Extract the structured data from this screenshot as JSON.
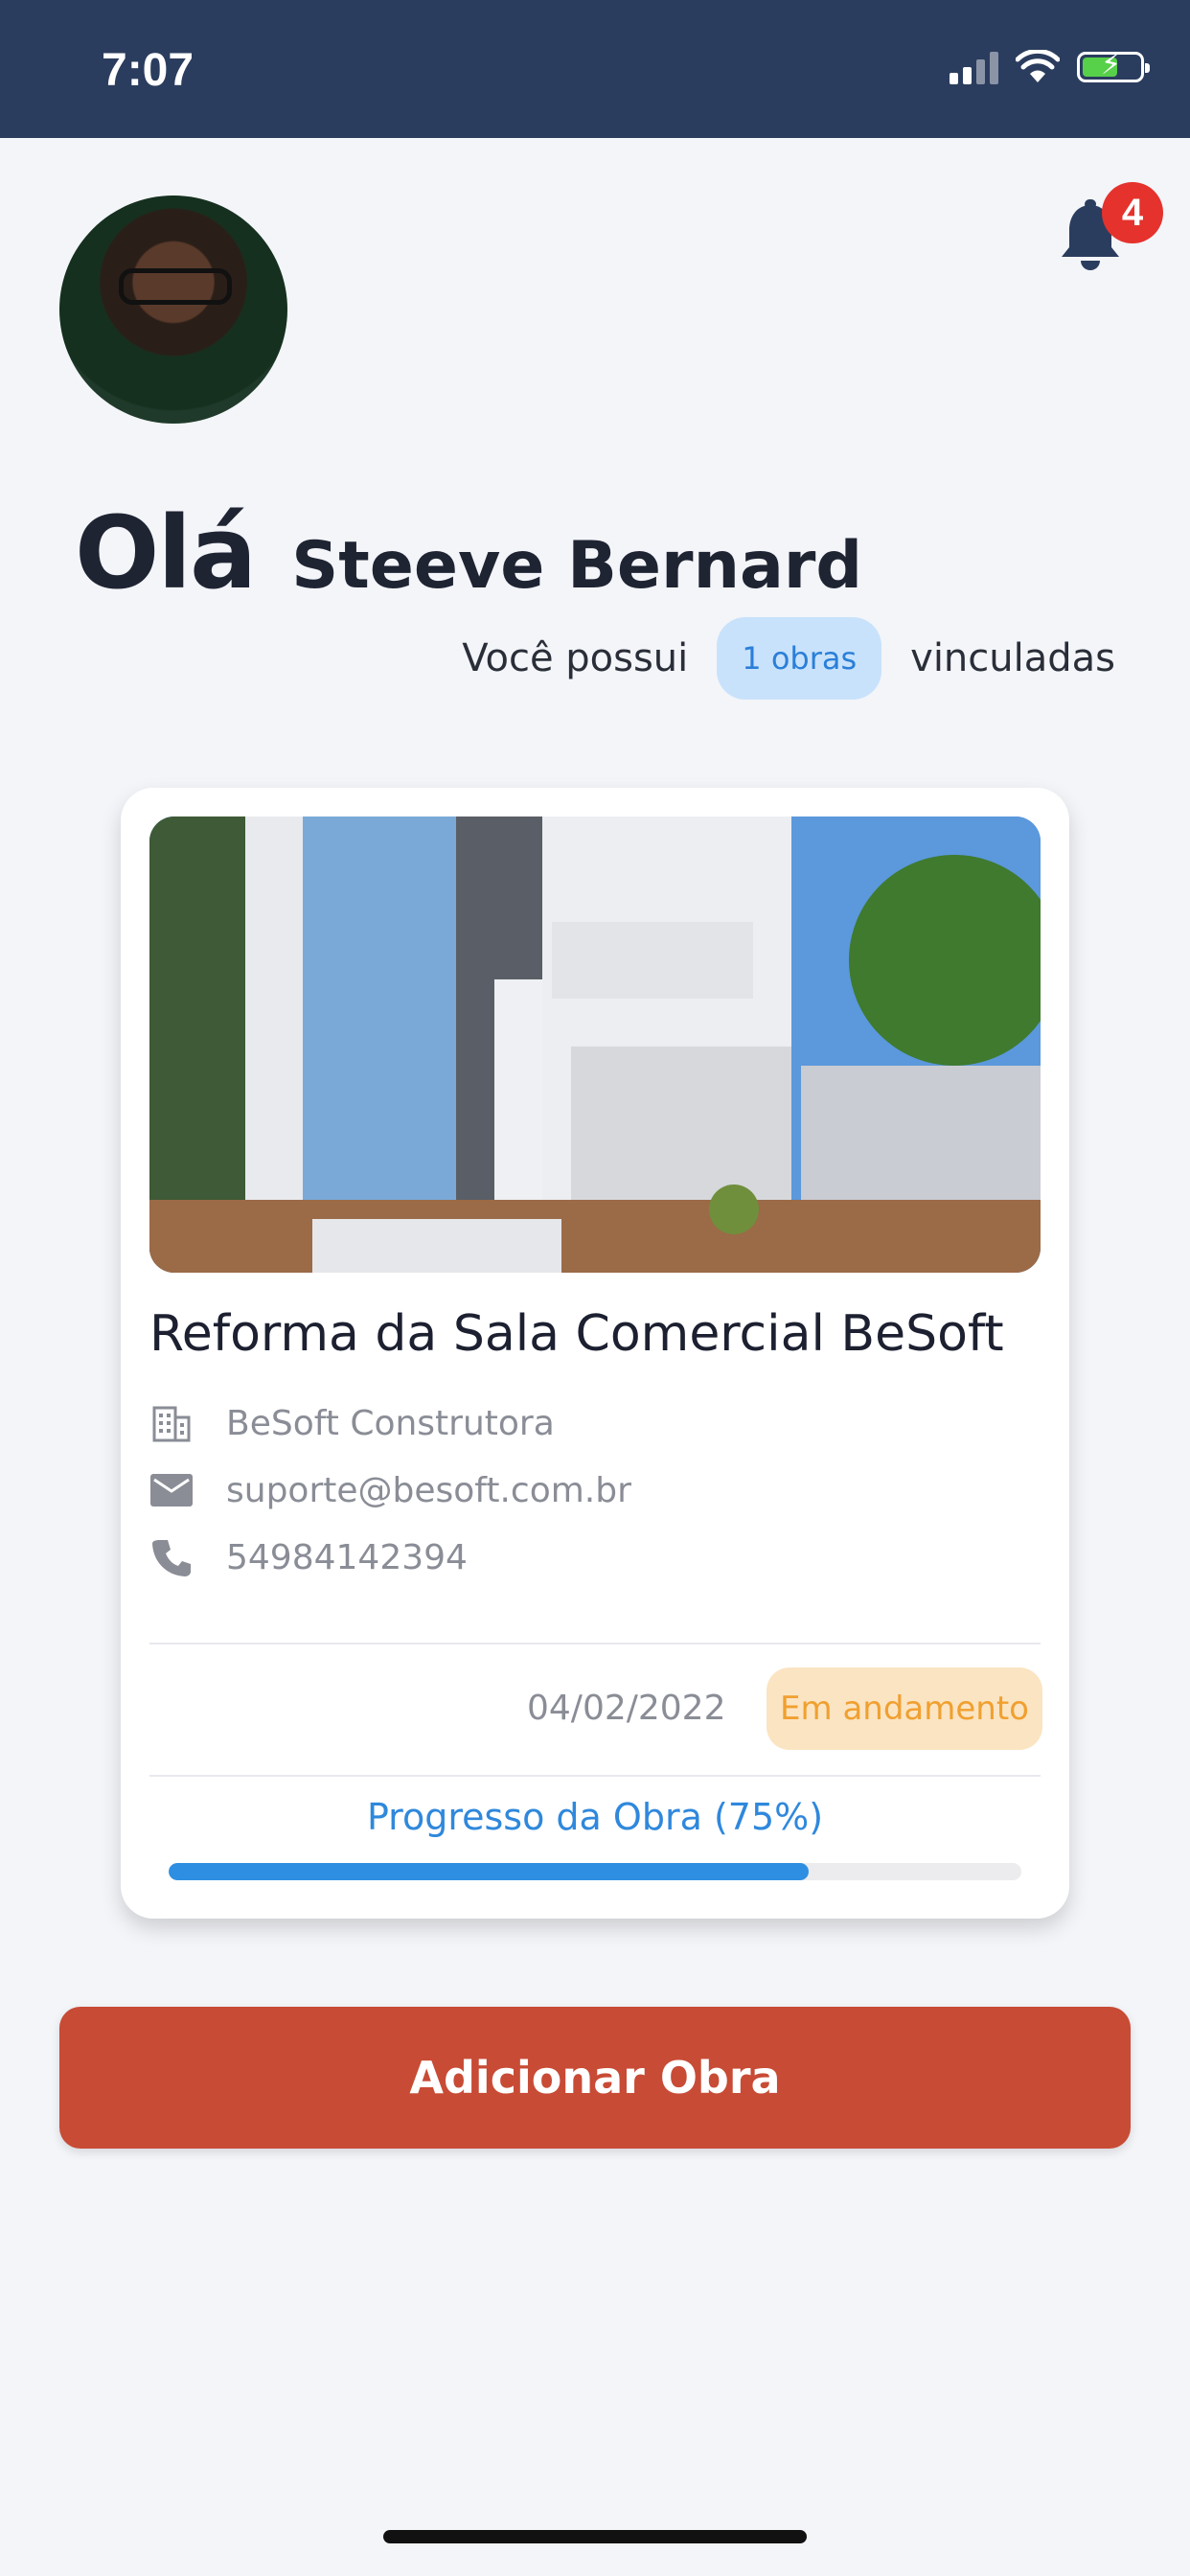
{
  "status_bar": {
    "time": "7:07",
    "icons": [
      "signal-icon",
      "wifi-icon",
      "battery-charging-icon"
    ]
  },
  "header": {
    "notifications_count": "4",
    "bell_icon": "bell-icon"
  },
  "greeting": {
    "hello": "Olá",
    "user_name": "Steeve Bernard"
  },
  "summary": {
    "prefix": "Você possui",
    "count_label": "1 obras",
    "suffix": "vinculadas"
  },
  "project_card": {
    "title": "Reforma da Sala Comercial BeSoft",
    "company": "BeSoft Construtora",
    "email": "suporte@besoft.com.br",
    "phone": "54984142394",
    "date": "04/02/2022",
    "status": "Em andamento",
    "progress_label": "Progresso da Obra (75%)",
    "progress_value": 0.75
  },
  "actions": {
    "add_label": "Adicionar Obra"
  },
  "colors": {
    "status_bar_bg": "#2b3d5e",
    "accent_button": "#c84b35",
    "progress_blue": "#2e8fe2",
    "status_badge_bg": "#fbe4c2",
    "status_badge_text": "#f0a030",
    "pill_bg": "#c9e2fb",
    "pill_text": "#2a7fd8",
    "notification_badge": "#e5322d"
  }
}
